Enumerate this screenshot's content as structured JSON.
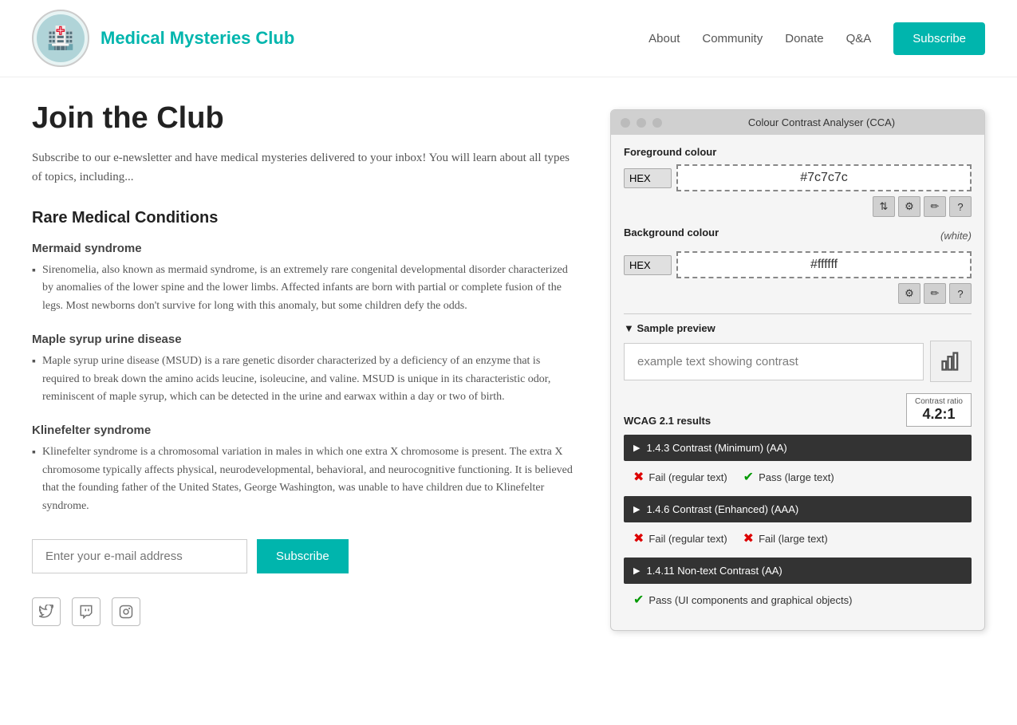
{
  "header": {
    "site_title": "Medical Mysteries Club",
    "logo_emoji": "🏥",
    "nav": {
      "items": [
        "About",
        "Community",
        "Donate",
        "Q&A"
      ],
      "subscribe_label": "Subscribe"
    }
  },
  "main": {
    "heading": "Join the Club",
    "intro": "Subscribe to our e-newsletter and have medical mysteries delivered to your inbox! You will learn about all types of topics, including...",
    "section_heading": "Rare Medical Conditions",
    "conditions": [
      {
        "title": "Mermaid syndrome",
        "body": "Sirenomelia, also known as mermaid syndrome, is an extremely rare congenital developmental disorder characterized by anomalies of the lower spine and the lower limbs. Affected infants are born with partial or complete fusion of the legs. Most newborns don't survive for long with this anomaly, but some children defy the odds."
      },
      {
        "title": "Maple syrup urine disease",
        "body": "Maple syrup urine disease (MSUD) is a rare genetic disorder characterized by a deficiency of an enzyme that is required to break down the amino acids leucine, isoleucine, and valine. MSUD is unique in its characteristic odor, reminiscent of maple syrup, which can be detected in the urine and earwax within a day or two of birth."
      },
      {
        "title": "Klinefelter syndrome",
        "body": "Klinefelter syndrome is a chromosomal variation in males in which one extra X chromosome is present. The extra X chromosome typically affects physical, neurodevelopmental, behavioral, and neurocognitive functioning. It is believed that the founding father of the United States, George Washington, was unable to have children due to Klinefelter syndrome."
      }
    ],
    "email_placeholder": "Enter your e-mail address",
    "subscribe_label": "Subscribe",
    "social_icons": [
      "twitter",
      "twitch",
      "instagram"
    ]
  },
  "cca": {
    "title": "Colour Contrast Analyser (CCA)",
    "foreground_label": "Foreground colour",
    "foreground_format": "HEX",
    "foreground_value": "#7c7c7c",
    "background_label": "Background colour",
    "background_note": "(white)",
    "background_format": "HEX",
    "background_value": "#ffffff",
    "sample_preview_label": "▼ Sample preview",
    "sample_text": "example text showing contrast",
    "wcag_label": "WCAG 2.1 results",
    "contrast_ratio_label": "Contrast ratio",
    "contrast_ratio_value": "4.2:1",
    "results": [
      {
        "id": "1.4.3",
        "label": "1.4.3 Contrast (Minimum) (AA)",
        "items": [
          {
            "pass": false,
            "text": "Fail (regular text)"
          },
          {
            "pass": true,
            "text": "Pass (large text)"
          }
        ]
      },
      {
        "id": "1.4.6",
        "label": "1.4.6 Contrast (Enhanced) (AAA)",
        "items": [
          {
            "pass": false,
            "text": "Fail (regular text)"
          },
          {
            "pass": false,
            "text": "Fail (large text)"
          }
        ]
      },
      {
        "id": "1.4.11",
        "label": "1.4.11 Non-text Contrast (AA)",
        "items": [
          {
            "pass": true,
            "text": "Pass (UI components and graphical objects)"
          }
        ]
      }
    ]
  }
}
